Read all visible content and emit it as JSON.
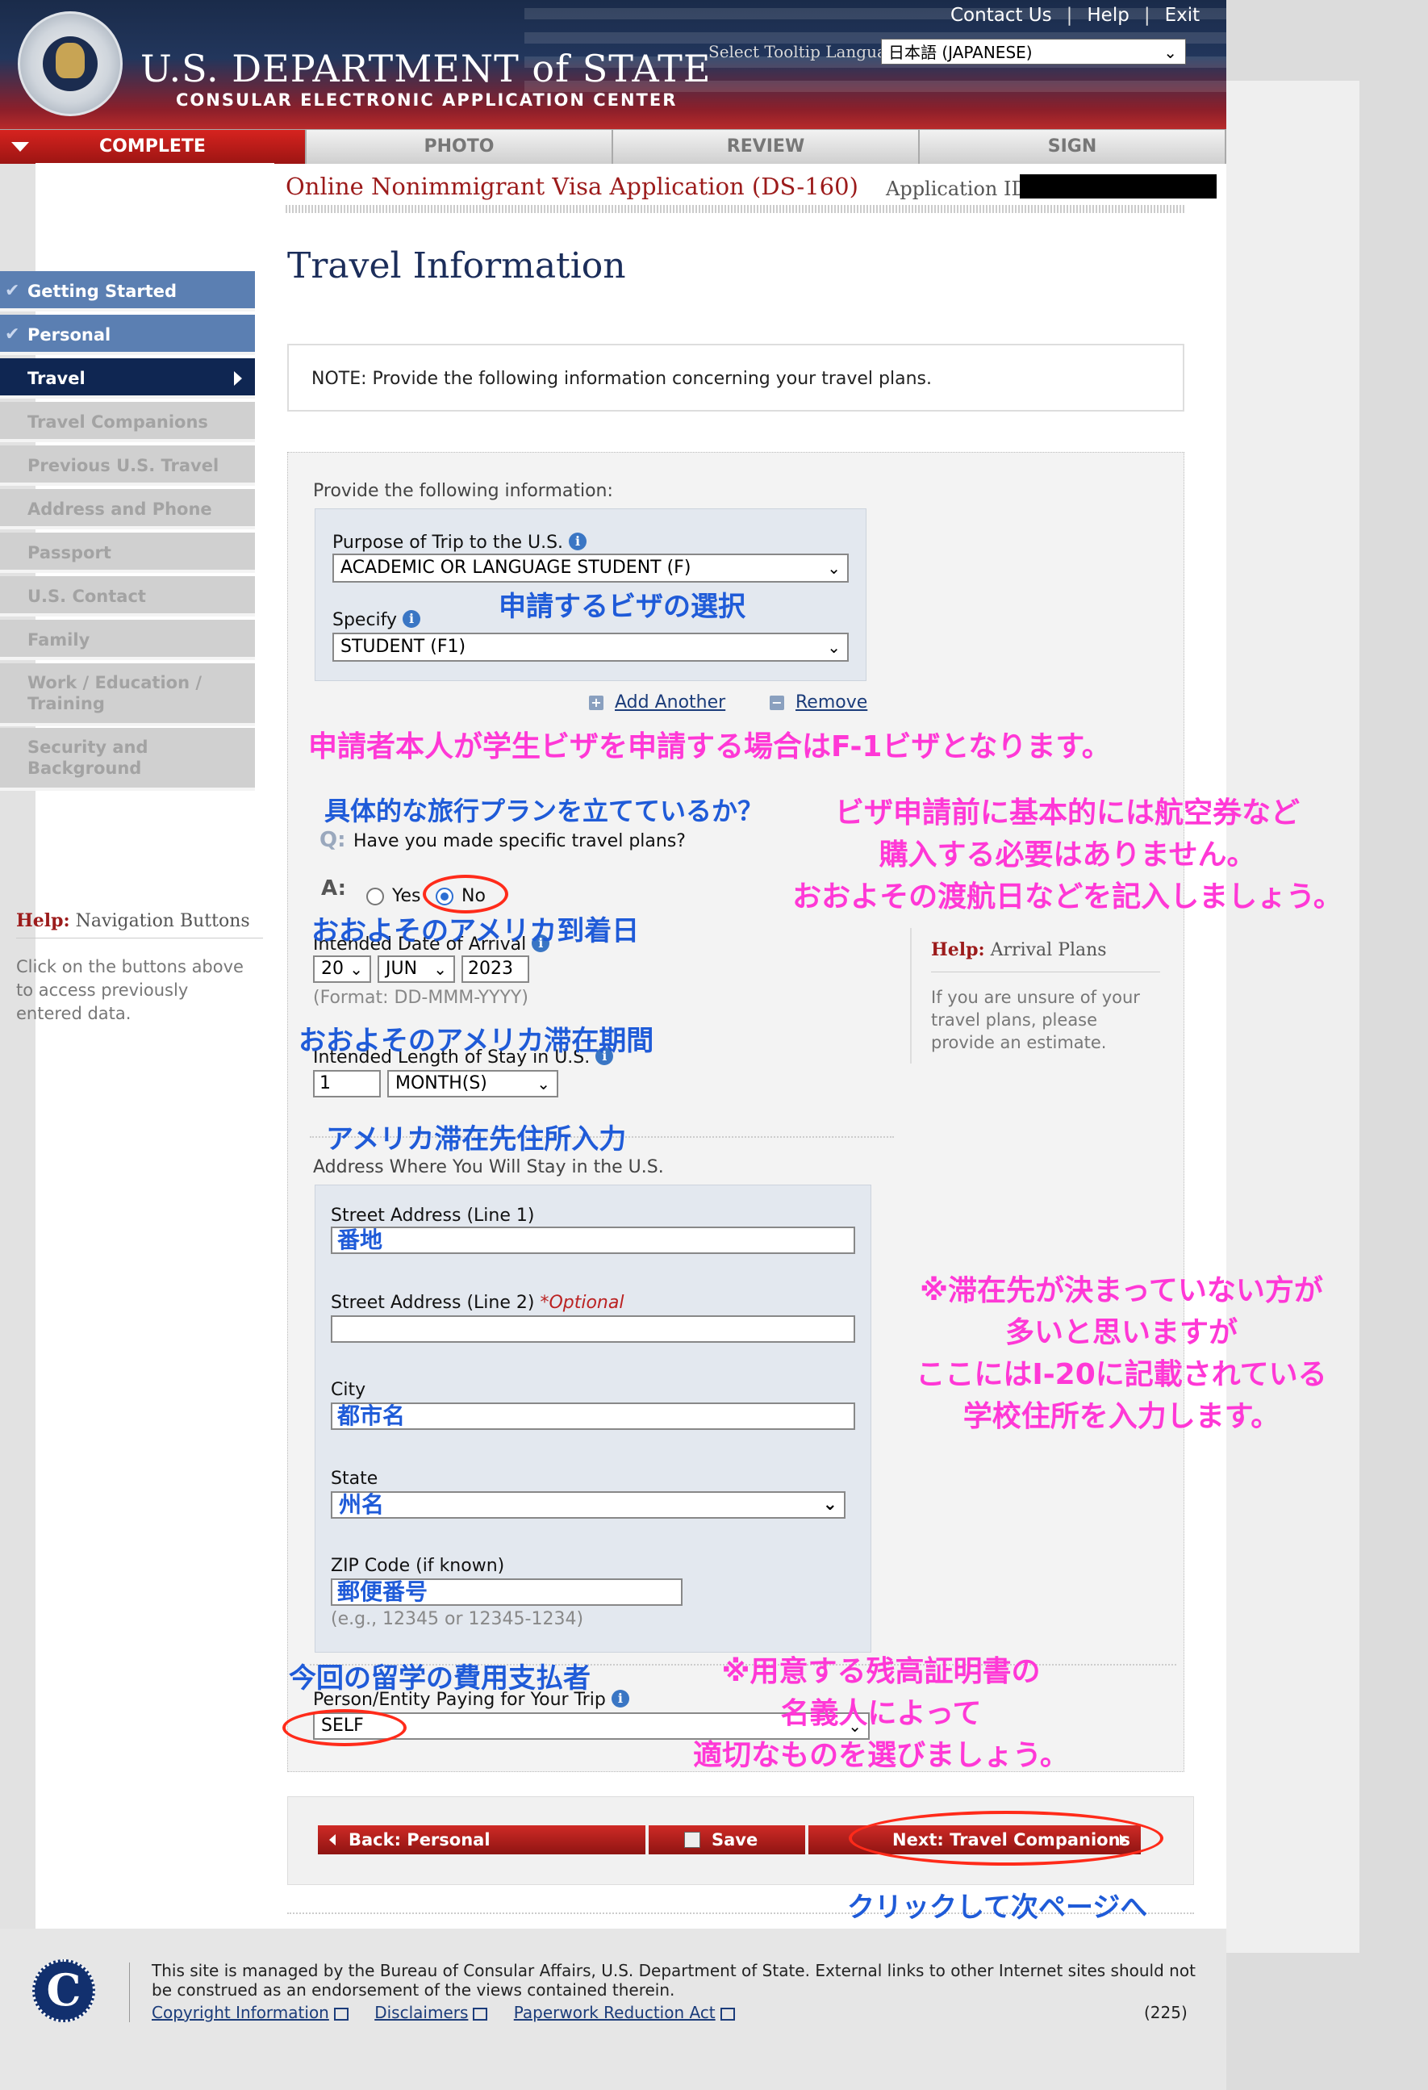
{
  "header": {
    "dept_title": "U.S. DEPARTMENT of STATE",
    "dept_subtitle": "CONSULAR ELECTRONIC APPLICATION CENTER",
    "links": [
      "Contact Us",
      "Help",
      "Exit"
    ],
    "tooltip_label": "Select Tooltip Language",
    "tooltip_language": "日本語 (JAPANESE)"
  },
  "tabs": [
    "COMPLETE",
    "PHOTO",
    "REVIEW",
    "SIGN"
  ],
  "app": {
    "title": "Online Nonimmigrant Visa Application (DS-160)",
    "id_label": "Application ID",
    "page_title": "Travel Information",
    "note": "NOTE: Provide the following information concerning your travel plans."
  },
  "sidebar": {
    "items": [
      {
        "label": "Getting Started",
        "state": "done"
      },
      {
        "label": "Personal",
        "state": "done"
      },
      {
        "label": "Travel",
        "state": "current"
      },
      {
        "label": "Travel Companions",
        "state": "todo"
      },
      {
        "label": "Previous U.S. Travel",
        "state": "todo"
      },
      {
        "label": "Address and Phone",
        "state": "todo"
      },
      {
        "label": "Passport",
        "state": "todo"
      },
      {
        "label": "U.S. Contact",
        "state": "todo"
      },
      {
        "label": "Family",
        "state": "todo"
      },
      {
        "label": "Work / Education / Training",
        "state": "todo"
      },
      {
        "label": "Security and Background",
        "state": "todo"
      }
    ],
    "help_prefix": "Help:",
    "help_title": "Navigation Buttons",
    "help_text": "Click on the buttons above to access previously entered data."
  },
  "form": {
    "provide_label": "Provide the following information:",
    "purpose_label": "Purpose of Trip to the U.S.",
    "purpose_value": "ACADEMIC OR LANGUAGE STUDENT (F)",
    "specify_label": "Specify",
    "specify_value": "STUDENT (F1)",
    "add_another": "Add Another",
    "remove": "Remove",
    "q_marker": "Q:",
    "question": "Have you made specific travel plans?",
    "a_marker": "A:",
    "yes_label": "Yes",
    "no_label": "No",
    "arrival_label": "Intended Date of Arrival",
    "arrival_day": "20",
    "arrival_month": "JUN",
    "arrival_year": "2023",
    "arrival_format": "(Format: DD-MMM-YYYY)",
    "stay_label": "Intended Length of Stay in U.S.",
    "stay_value": "1",
    "stay_unit": "MONTH(S)",
    "address_label": "Address Where You Will Stay in the U.S.",
    "street1_label": "Street Address (Line 1)",
    "street1_value": "番地",
    "street2_label": "Street Address (Line 2)",
    "street2_optional": "*Optional",
    "city_label": "City",
    "city_value": "都市名",
    "state_label": "State",
    "state_value": "州名",
    "zip_label": "ZIP Code (if known)",
    "zip_value": "郵便番号",
    "zip_example": "(e.g., 12345 or 12345-1234)",
    "payer_label": "Person/Entity Paying for Your Trip",
    "payer_value": "SELF"
  },
  "help_arrival": {
    "prefix": "Help:",
    "title": "Arrival Plans",
    "text": "If you are unsure of your travel plans, please provide an estimate."
  },
  "buttons": {
    "back": "Back: Personal",
    "save": "Save",
    "next": "Next: Travel Companions"
  },
  "annotations": {
    "visa_select": "申請するビザの選択",
    "f1_note": "申請者本人が学生ビザを申請する場合はF-1ビザとなります。",
    "plans_q": "具体的な旅行プランを立てているか？",
    "plans_note_1": "ビザ申請前に基本的には航空券など",
    "plans_note_2": "購入する必要はありません。",
    "plans_note_3": "おおよその渡航日などを記入しましょう。",
    "arrival": "おおよそのアメリカ到着日",
    "stay": "おおよそのアメリカ滞在期間",
    "address": "アメリカ滞在先住所入力",
    "addr_note_1": "※滞在先が決まっていない方が",
    "addr_note_2": "多いと思いますが",
    "addr_note_3": "ここにはI-20に記載されている",
    "addr_note_4": "学校住所を入力します。",
    "payer": "今回の留学の費用支払者",
    "payer_note_1": "※用意する残高証明書の",
    "payer_note_2": "名義人によって",
    "payer_note_3": "適切なものを選びましょう。",
    "next": "クリックして次ページへ"
  },
  "footer": {
    "logo_letter": "C",
    "text": "This site is managed by the Bureau of Consular Affairs, U.S. Department of State. External links to other Internet sites should not be construed as an endorsement of the views contained therein.",
    "links": [
      "Copyright Information",
      "Disclaimers",
      "Paperwork Reduction Act"
    ],
    "count": "(225)"
  },
  "colors": {
    "header_navy": "#1a2b4a",
    "header_red": "#b82a2a",
    "nav_done": "#5b7fb2",
    "nav_current": "#0f2652",
    "annotation_blue": "#1f5bd8",
    "annotation_pink": "#ff38d6",
    "highlight_ellipse": "#ff2b1a"
  }
}
